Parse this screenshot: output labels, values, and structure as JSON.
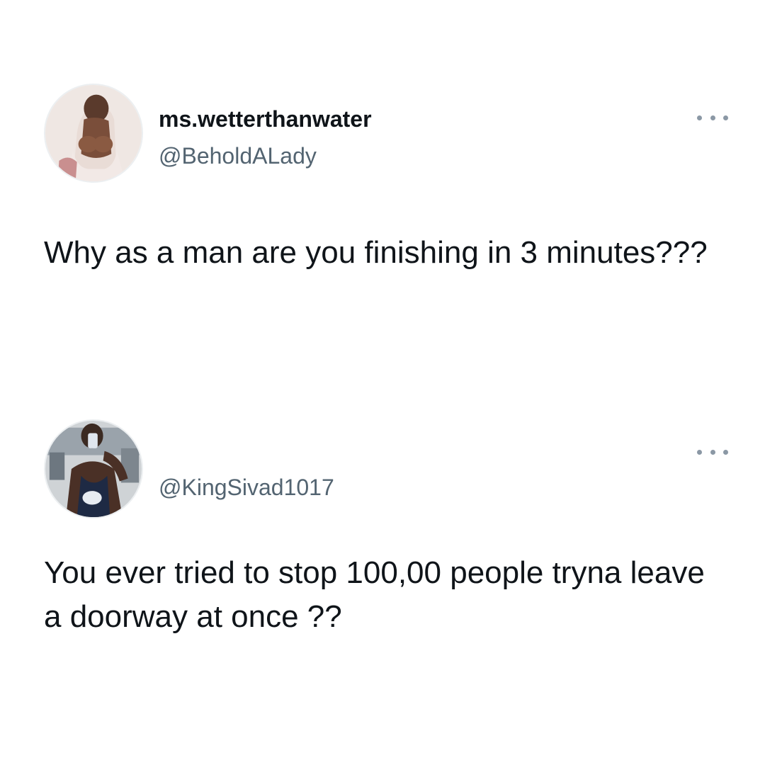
{
  "tweets": [
    {
      "display_name": "ms.wetterthanwater",
      "handle": "@BeholdALady",
      "text": "Why as a man are you finishing in 3 minutes???",
      "more_icon": "more-horizontal-icon"
    },
    {
      "display_name": "",
      "handle": "@KingSivad1017",
      "text": "You ever tried to stop 100,00 people tryna leave a doorway at once ??",
      "more_icon": "more-horizontal-icon"
    }
  ],
  "colors": {
    "background": "#ffffff",
    "text_primary": "#0f1419",
    "text_secondary": "#536471",
    "icon_gray": "#8b98a5"
  }
}
